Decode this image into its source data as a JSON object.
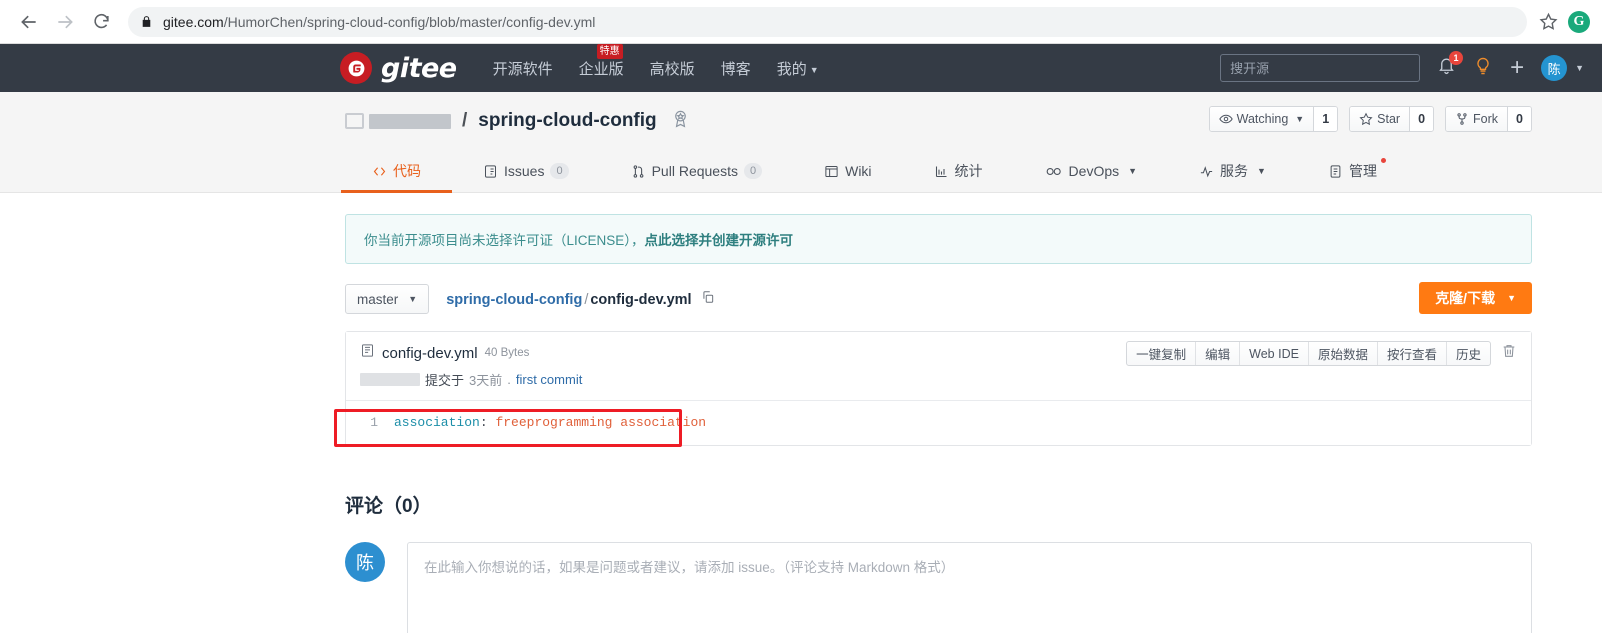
{
  "browser": {
    "back_icon": "arrow-left-icon",
    "forward_icon": "arrow-right-icon",
    "reload_icon": "reload-icon",
    "lock_icon": "lock-icon",
    "url_host": "gitee.com",
    "url_path": "/HumorChen/spring-cloud-config/blob/master/config-dev.yml",
    "url_full": "gitee.com/HumorChen/spring-cloud-config/blob/master/config-dev.yml",
    "bookmark_icon": "star-outline-icon",
    "profile_initial": "G"
  },
  "topnav": {
    "logo_letter": "G",
    "logo_text": "gitee",
    "links": [
      {
        "label": "开源软件",
        "badge": null,
        "caret": false
      },
      {
        "label": "企业版",
        "badge": "特惠",
        "caret": false
      },
      {
        "label": "高校版",
        "badge": null,
        "caret": false
      },
      {
        "label": "博客",
        "badge": null,
        "caret": false
      },
      {
        "label": "我的",
        "badge": null,
        "caret": true
      }
    ],
    "search_placeholder": "搜开源",
    "search_value": "",
    "notification_count": "1",
    "bell_icon": "bell-icon",
    "bulb_icon": "lightbulb-icon",
    "plus_icon": "plus-icon",
    "avatar_initial": "陈"
  },
  "repo": {
    "owner_redacted": true,
    "separator": "/",
    "name": "spring-cloud-config",
    "badge_icon": "award-badge-icon",
    "actions": {
      "watch_label": "Watching",
      "watch_count": "1",
      "star_label": "Star",
      "star_count": "0",
      "fork_label": "Fork",
      "fork_count": "0"
    },
    "tabs": [
      {
        "label": "代码",
        "icon": "code-icon",
        "count": null,
        "active": true,
        "caret": false,
        "dot": false
      },
      {
        "label": "Issues",
        "icon": "issue-icon",
        "count": "0",
        "active": false,
        "caret": false,
        "dot": false
      },
      {
        "label": "Pull Requests",
        "icon": "pull-request-icon",
        "count": "0",
        "active": false,
        "caret": false,
        "dot": false
      },
      {
        "label": "Wiki",
        "icon": "book-icon",
        "count": null,
        "active": false,
        "caret": false,
        "dot": false
      },
      {
        "label": "统计",
        "icon": "chart-icon",
        "count": null,
        "active": false,
        "caret": false,
        "dot": false
      },
      {
        "label": "DevOps",
        "icon": "infinity-icon",
        "count": null,
        "active": false,
        "caret": true,
        "dot": false
      },
      {
        "label": "服务",
        "icon": "pulse-icon",
        "count": null,
        "active": false,
        "caret": true,
        "dot": false
      },
      {
        "label": "管理",
        "icon": "clipboard-icon",
        "count": null,
        "active": false,
        "caret": false,
        "dot": true
      }
    ]
  },
  "alert": {
    "text": "你当前开源项目尚未选择许可证（LICENSE），",
    "link": "点此选择并创建开源许可"
  },
  "filebar": {
    "branch": "master",
    "crumb_repo": "spring-cloud-config",
    "crumb_sep": "/",
    "crumb_file": "config-dev.yml",
    "copy_path_icon": "copy-icon",
    "clone_label": "克隆/下载"
  },
  "file": {
    "file_icon": "file-text-icon",
    "name": "config-dev.yml",
    "size": "40 Bytes",
    "commit_verb": "提交于",
    "commit_time": "3天前",
    "commit_dot": ".",
    "commit_message": "first commit",
    "actions": [
      "一键复制",
      "编辑",
      "Web IDE",
      "原始数据",
      "按行查看",
      "历史"
    ],
    "delete_icon": "trash-icon",
    "code": [
      {
        "number": "1",
        "key": "association",
        "punct": ":",
        "value": "freeprogramming association"
      }
    ],
    "highlight_color": "#ee1c25"
  },
  "comments": {
    "title": "评论（0）",
    "avatar_initial": "陈",
    "placeholder": "在此输入你想说的话，如果是问题或者建议，请添加 issue。（评论支持 Markdown 格式）"
  },
  "colors": {
    "brand_red": "#c71d23",
    "accent_orange": "#e8601c",
    "clone_orange": "#ff7a12",
    "nav_dark": "#343b45",
    "link_blue": "#2f6ca8"
  }
}
